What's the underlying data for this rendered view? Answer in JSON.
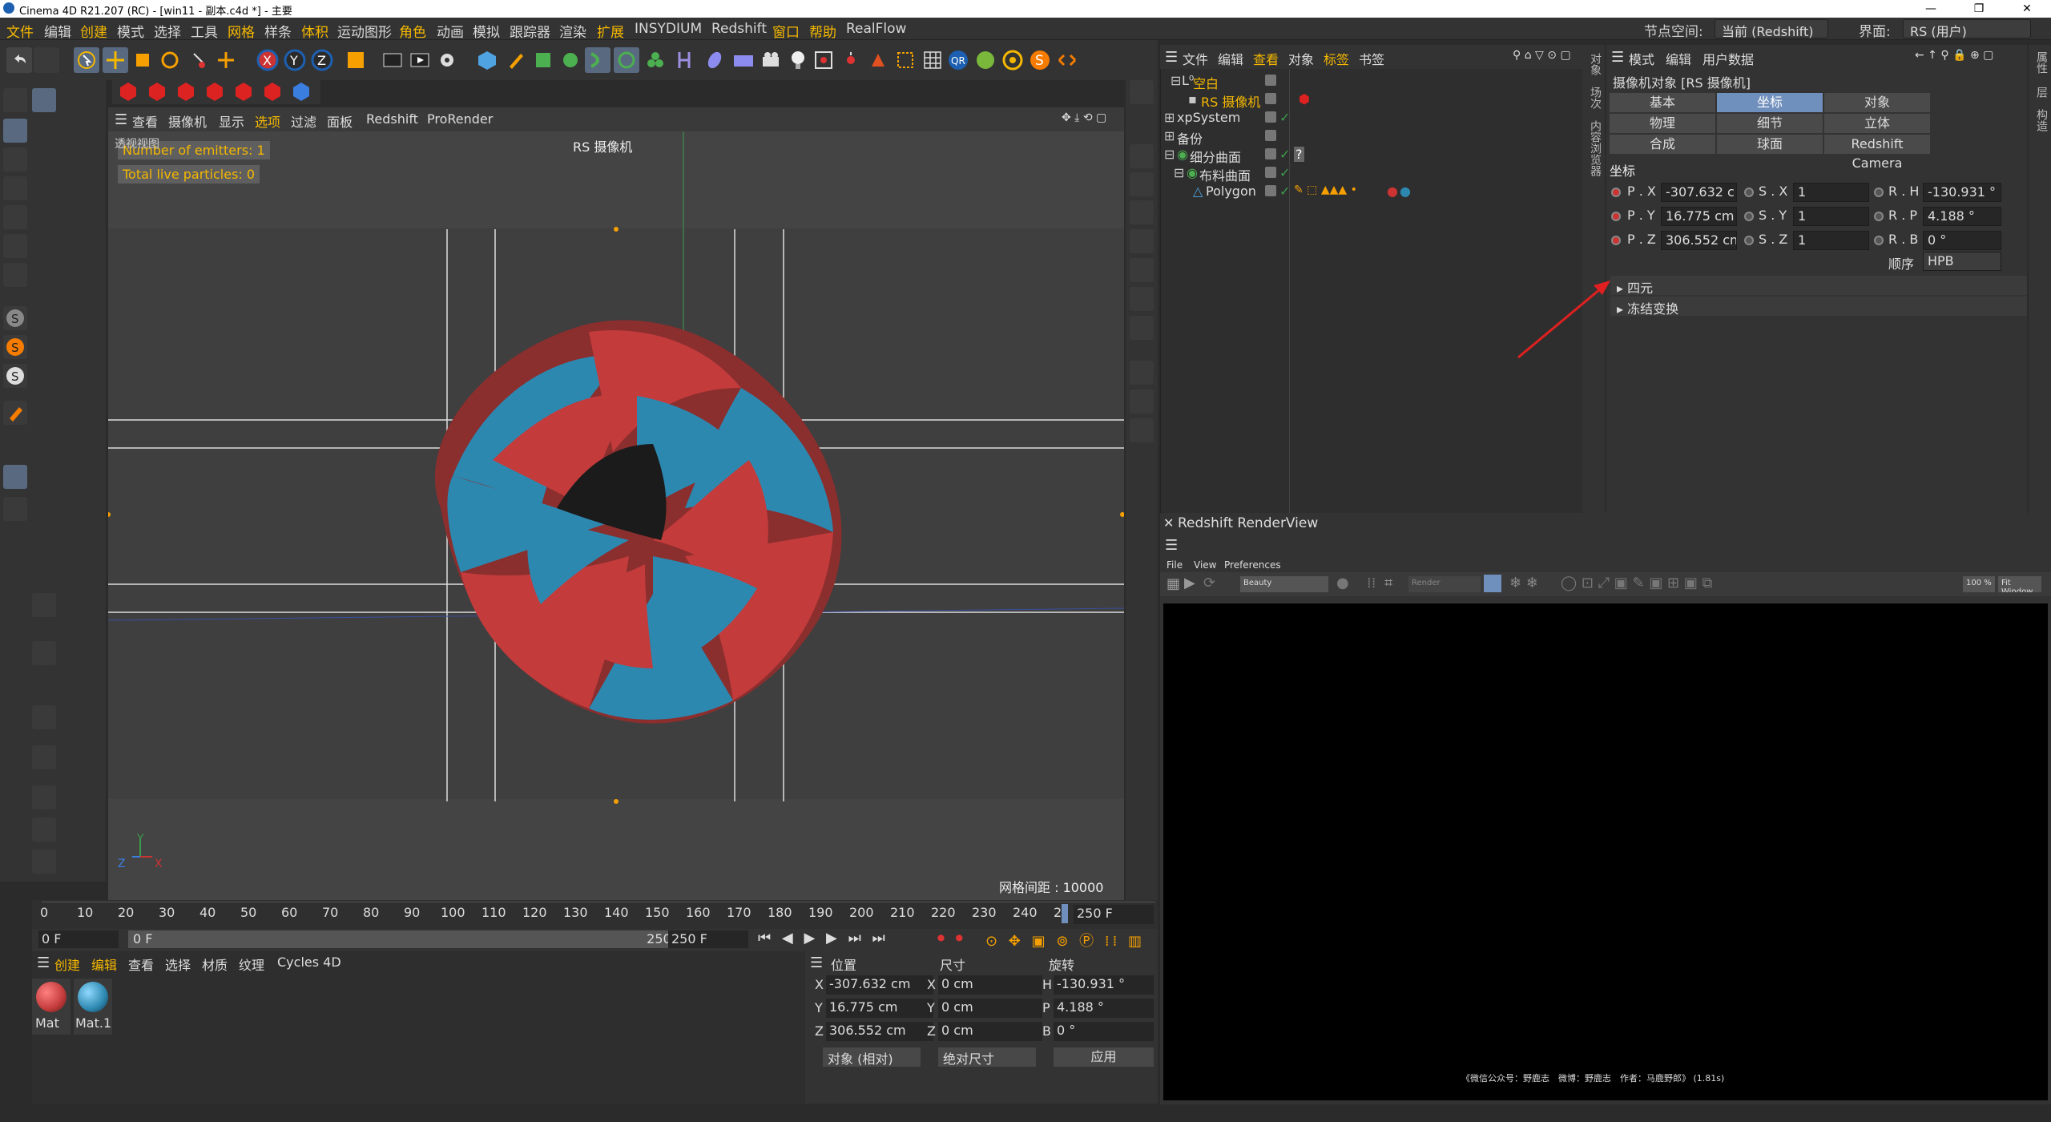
{
  "window": {
    "title": "Cinema 4D R21.207 (RC) - [win11 - 副本.c4d *] - 主要",
    "controls": [
      "—",
      "❐",
      "✕"
    ]
  },
  "menubar": {
    "items": [
      "文件",
      "编辑",
      "创建",
      "模式",
      "选择",
      "工具",
      "网格",
      "样条",
      "体积",
      "运动图形",
      "角色",
      "动画",
      "模拟",
      "跟踪器",
      "渲染",
      "扩展",
      "INSYDIUM",
      "Redshift",
      "窗口",
      "帮助",
      "RealFlow"
    ],
    "node_space_label": "节点空间:",
    "node_space_value": "当前 (Redshift)",
    "layout_label": "界面:",
    "layout_value": "RS (用户)"
  },
  "viewport": {
    "menu": [
      "查看",
      "摄像机",
      "显示",
      "选项",
      "过滤",
      "面板",
      "Redshift",
      "ProRender"
    ],
    "corner_label": "透视视图",
    "camera_label": "RS 摄像机",
    "hud": [
      "Number of emitters: 1",
      "Total live particles: 0"
    ],
    "grid_info": "网格间距 : 10000 cm",
    "axis": {
      "y": "Y",
      "z": "Z",
      "x": "X"
    },
    "colors": {
      "red": "#c33b3b",
      "blue": "#2d88b0"
    }
  },
  "object_manager": {
    "menu": [
      "文件",
      "编辑",
      "查看",
      "对象",
      "标签",
      "书签"
    ],
    "objects": [
      {
        "name": "空白",
        "color": "#f5b800"
      },
      {
        "name": "RS 摄像机",
        "color": "#f5b800"
      },
      {
        "name": "xpSystem",
        "color": "#dddddd"
      },
      {
        "name": "备份",
        "color": "#dddddd"
      },
      {
        "name": "细分曲面",
        "color": "#dddddd"
      },
      {
        "name": "布料曲面",
        "color": "#dddddd"
      },
      {
        "name": "Polygon",
        "color": "#dddddd"
      }
    ]
  },
  "side_tabs": [
    "对象",
    "场次",
    "内容浏览器"
  ],
  "right_edge_tabs": [
    "属性",
    "层",
    "构造"
  ],
  "attribute_manager": {
    "menu": [
      "模式",
      "编辑",
      "用户数据"
    ],
    "object_title": "摄像机对象 [RS 摄像机]",
    "tabs": [
      "基本",
      "坐标",
      "对象",
      "物理",
      "细节",
      "立体",
      "合成",
      "球面",
      "Redshift Camera"
    ],
    "selected_tab": "坐标",
    "section": "坐标",
    "fields": {
      "px_label": "P . X",
      "px": "-307.632 c",
      "py_label": "P . Y",
      "py": "16.775 cm",
      "pz_label": "P . Z",
      "pz": "306.552 cn",
      "sx_label": "S . X",
      "sx": "1",
      "sy_label": "S . Y",
      "sy": "1",
      "sz_label": "S . Z",
      "sz": "1",
      "rh_label": "R . H",
      "rh": "-130.931 °",
      "rp_label": "R . P",
      "rp": "4.188 °",
      "rb_label": "R . B",
      "rb": "0 °"
    },
    "order_label": "顺序",
    "order_value": "HPB",
    "collapsed": [
      "四元",
      "冻结变换"
    ]
  },
  "renderview": {
    "title": "Redshift RenderView",
    "menu": [
      "File",
      "View",
      "Preferences"
    ],
    "aov": "Beauty",
    "render_mode": "Render",
    "zoom": "100 %",
    "fit": "Fit Window",
    "footer": "《微信公众号：野鹿志　微博：野鹿志　作者：马鹿野郎》 (1.81s)"
  },
  "timeline": {
    "ticks": [
      "0",
      "10",
      "20",
      "30",
      "40",
      "50",
      "60",
      "70",
      "80",
      "90",
      "100",
      "110",
      "120",
      "130",
      "140",
      "150",
      "160",
      "170",
      "180",
      "190",
      "200",
      "210",
      "220",
      "230",
      "240",
      "2"
    ],
    "end_frame": "250 F",
    "current": "0 F",
    "start": "0 F",
    "range_end": "250 F",
    "max": "250 F"
  },
  "material_manager": {
    "menu": [
      "创建",
      "编辑",
      "查看",
      "选择",
      "材质",
      "纹理",
      "Cycles 4D"
    ],
    "materials": [
      {
        "name": "Mat",
        "color": "#c33b3b"
      },
      {
        "name": "Mat.1",
        "color": "#2d88b0"
      }
    ]
  },
  "coord_manager": {
    "headers": [
      "位置",
      "尺寸",
      "旋转"
    ],
    "rows": [
      {
        "l1": "X",
        "v1": "-307.632 cm",
        "l2": "X",
        "v2": "0 cm",
        "l3": "H",
        "v3": "-130.931 °"
      },
      {
        "l1": "Y",
        "v1": "16.775 cm",
        "l2": "Y",
        "v2": "0 cm",
        "l3": "P",
        "v3": "4.188 °"
      },
      {
        "l1": "Z",
        "v1": "306.552 cm",
        "l2": "Z",
        "v2": "0 cm",
        "l3": "B",
        "v3": "0 °"
      }
    ],
    "mode": "对象 (相对)",
    "size_mode": "绝对尺寸",
    "apply": "应用"
  }
}
